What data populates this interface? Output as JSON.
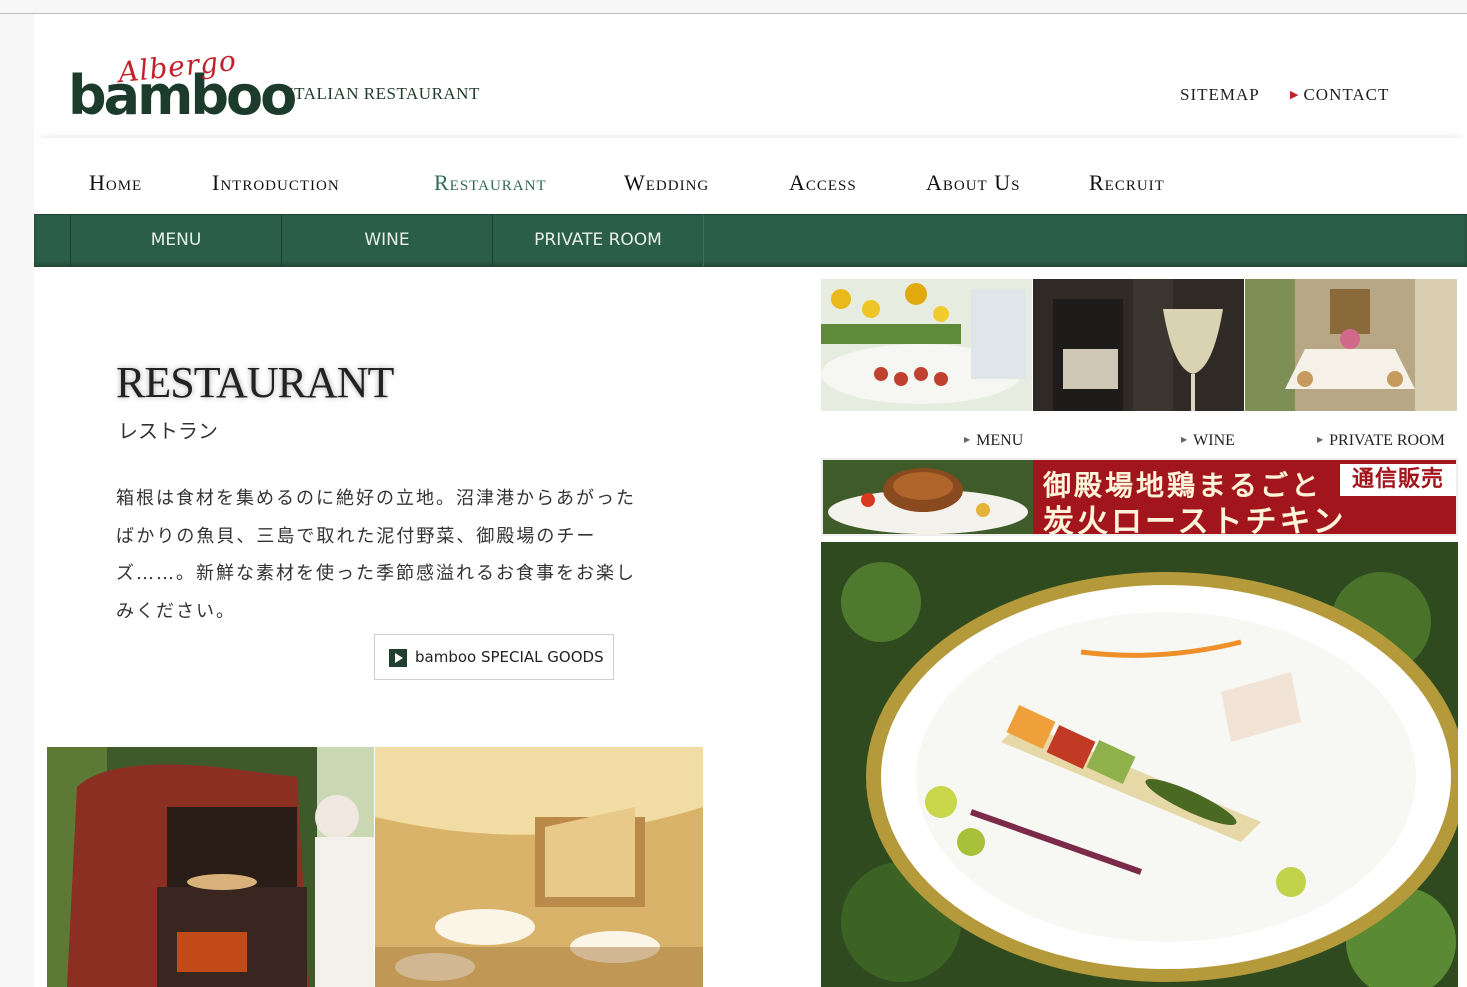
{
  "header": {
    "logo_script": "Albergo",
    "logo_word": "bamboo",
    "tagline": "ITALIAN RESTAURANT",
    "sitemap": "SITEMAP",
    "contact": "CONTACT"
  },
  "main_nav": {
    "items": [
      {
        "label": "Home"
      },
      {
        "label": "Introduction"
      },
      {
        "label": "Restaurant",
        "active": true
      },
      {
        "label": "Wedding"
      },
      {
        "label": "Access"
      },
      {
        "label": "About Us"
      },
      {
        "label": "Recruit"
      }
    ]
  },
  "sub_nav": {
    "items": [
      {
        "label": "MENU"
      },
      {
        "label": "WINE"
      },
      {
        "label": "PRIVATE ROOM"
      }
    ]
  },
  "content": {
    "title": "RESTAURANT",
    "title_jp": "レストラン",
    "body": "箱根は食材を集めるのに絶好の立地。沼津港からあがったばかりの魚貝、三島で取れた泥付野菜、御殿場のチーズ……。新鮮な素材を使った季節感溢れるお食事をお楽しみください。",
    "goods_button": "bamboo SPECIAL GOODS"
  },
  "thumbnails": [
    {
      "label": "MENU"
    },
    {
      "label": "WINE"
    },
    {
      "label": "PRIVATE ROOM"
    }
  ],
  "banner": {
    "line1": "御殿場地鶏まるごと",
    "line2": "炭火ローストチキン",
    "badge": "通信販売"
  },
  "colors": {
    "brand_green": "#2b5e48",
    "accent_red": "#c4202a",
    "banner_red": "#a3151c"
  }
}
